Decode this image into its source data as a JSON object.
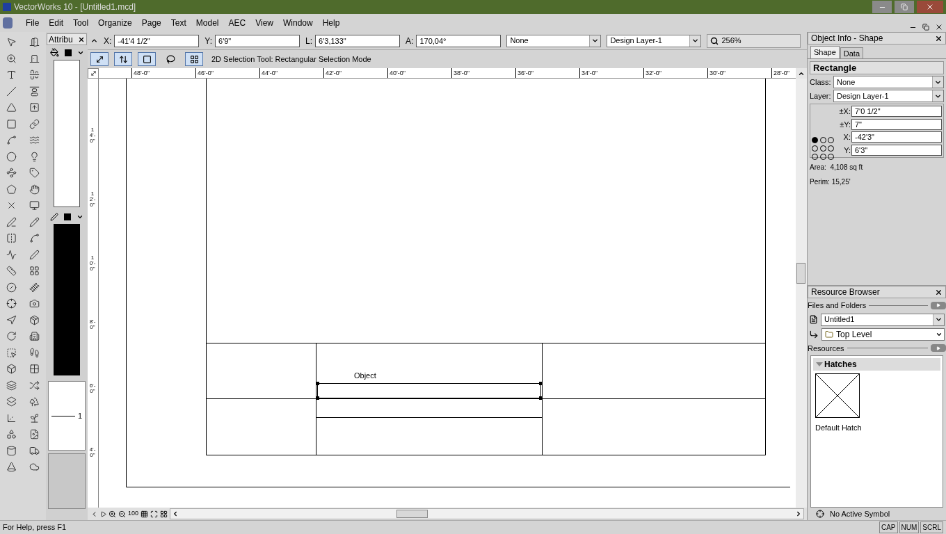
{
  "window": {
    "title": "VectorWorks 10 - [Untitled1.mcd]"
  },
  "menu": [
    "File",
    "Edit",
    "Tool",
    "Organize",
    "Page",
    "Text",
    "Model",
    "AEC",
    "View",
    "Window",
    "Help"
  ],
  "coords": [
    {
      "label": "X:",
      "value": "-41'4 1/2\""
    },
    {
      "label": "Y:",
      "value": "6'9\""
    },
    {
      "label": "L:",
      "value": "6'3,133\""
    },
    {
      "label": "A:",
      "value": "170,04°"
    }
  ],
  "class_select": "None",
  "layer_select": "Design Layer-1",
  "zoom": "256%",
  "mode_buttons": [
    {
      "selected": true
    },
    {
      "selected": true
    },
    {
      "selected": true
    },
    {
      "selected": false
    },
    {
      "selected": true
    }
  ],
  "mode_label": "2D Selection Tool: Rectangular Selection Mode",
  "attributes": {
    "title": "Attribu",
    "line_weight": "1"
  },
  "ruler": {
    "horizontal": [
      "48'-0\"",
      "46'-0\"",
      "44'-0\"",
      "42'-0\"",
      "40'-0\"",
      "38'-0\"",
      "36'-0\"",
      "34'-0\"",
      "32'-0\"",
      "30'-0\"",
      "28'-0\""
    ],
    "vertical": [
      "14'-0\"",
      "12'-0\"",
      "10'-0\"",
      "8'-0\"",
      "6'-0\"",
      "4'-0\""
    ]
  },
  "canvas": {
    "label": "Object"
  },
  "nav_zoom": "100",
  "object_info": {
    "title": "Object Info - Shape",
    "tabs": [
      {
        "label": "Shape",
        "selected": true
      },
      {
        "label": "Data",
        "selected": false
      }
    ],
    "heading": "Rectangle",
    "selects": [
      {
        "label": "Class:",
        "value": "None"
      },
      {
        "label": "Layer:",
        "value": "Design Layer-1"
      }
    ],
    "fields": [
      {
        "label": "±X:",
        "value": "7'0 1/2\""
      },
      {
        "label": "±Y:",
        "value": "7\""
      },
      {
        "label": "X:",
        "value": "-42'3\""
      },
      {
        "label": "Y:",
        "value": "6'3\""
      }
    ],
    "stats": [
      "Area:  4,108 sq ft",
      "Perim: 15,25'"
    ]
  },
  "resource_browser": {
    "title": "Resource Browser",
    "files_label": "Files and Folders",
    "file": "Untitled1",
    "folder": "Top Level",
    "resources_label": "Resources",
    "group": {
      "label": "Hatches",
      "expanded": true,
      "items": [
        {
          "label": "Default Hatch"
        }
      ]
    },
    "footer": "No Active Symbol"
  },
  "status_bar": {
    "help": "For Help, press F1",
    "indicators": [
      "CAP",
      "NUM",
      "SCRL"
    ]
  }
}
